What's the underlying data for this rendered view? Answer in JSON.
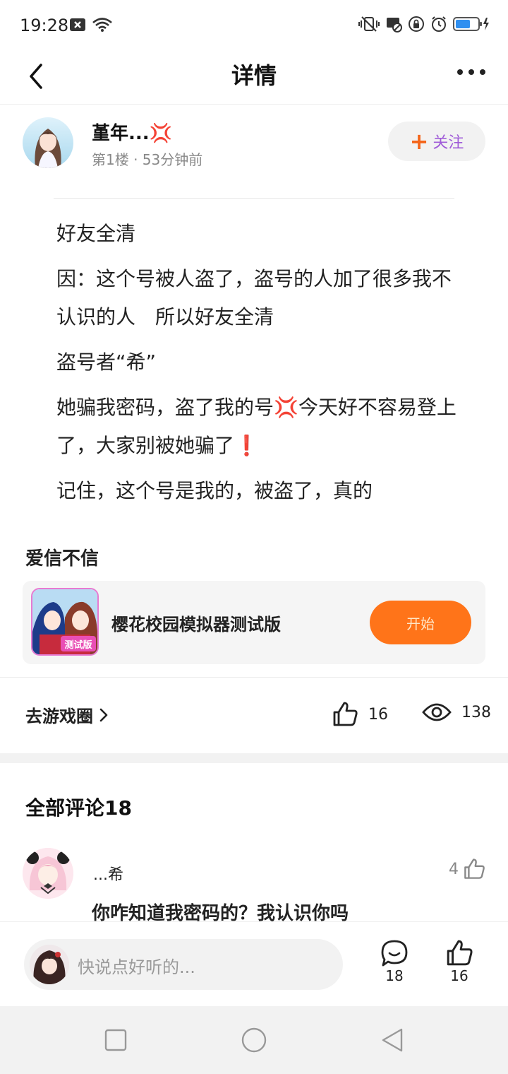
{
  "status_bar": {
    "time": "19:28"
  },
  "header": {
    "title": "详情"
  },
  "author": {
    "name": "堇年...💢",
    "meta": "第1楼 · 53分钟前",
    "follow_label": "关注"
  },
  "post": {
    "paragraphs": [
      "好友全清",
      "因：这个号被人盗了，盗号的人加了很多我不认识的人　所以好友全清",
      "盗号者“希”",
      "她骗我密码，盗了我的号💢今天好不容易登上了，大家别被她骗了❗",
      "记住，这个号是我的，被盗了，真的"
    ]
  },
  "circle": {
    "label": "爱信不信",
    "game_name": "樱花校园模拟器测试版",
    "game_icon_badge": "测试版",
    "start_label": "开始"
  },
  "actions": {
    "goto_circle": "去游戏圈",
    "likes": "16",
    "views": "138"
  },
  "comments": {
    "title": "全部评论18",
    "items": [
      {
        "name": "...希",
        "likes": "4",
        "text": "你咋知道我密码的？我认识你吗"
      }
    ]
  },
  "input_bar": {
    "placeholder": "快说点好听的...",
    "comment_count": "18",
    "like_count": "16"
  },
  "colors": {
    "accent": "#ff7419",
    "follow_plus": "#f4651a",
    "text_primary": "#222222",
    "text_secondary": "#888888"
  }
}
